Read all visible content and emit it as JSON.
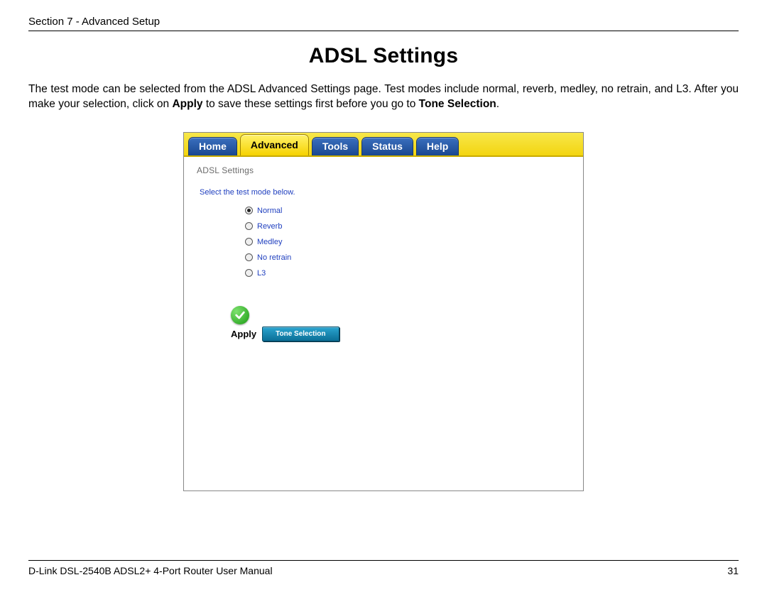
{
  "header": {
    "section": "Section 7 - Advanced Setup"
  },
  "title": "ADSL Settings",
  "paragraph": {
    "pre": "The test mode can be selected from the ADSL Advanced Settings page. Test modes include normal, reverb, medley, no retrain, and L3. After you make your selection, click on ",
    "apply": "Apply",
    "mid": " to save these settings ﬁrst before you go to ",
    "tone": "Tone Selection",
    "end": "."
  },
  "tabs": {
    "items": [
      "Home",
      "Advanced",
      "Tools",
      "Status",
      "Help"
    ],
    "active_index": 1
  },
  "panel": {
    "title": "ADSL Settings",
    "instruction": "Select the test mode below.",
    "options": [
      "Normal",
      "Reverb",
      "Medley",
      "No retrain",
      "L3"
    ],
    "selected_index": 0,
    "apply_label": "Apply",
    "tone_button": "Tone Selection"
  },
  "footer": {
    "left": "D-Link DSL-2540B ADSL2+ 4-Port Router User Manual",
    "right": "31"
  }
}
